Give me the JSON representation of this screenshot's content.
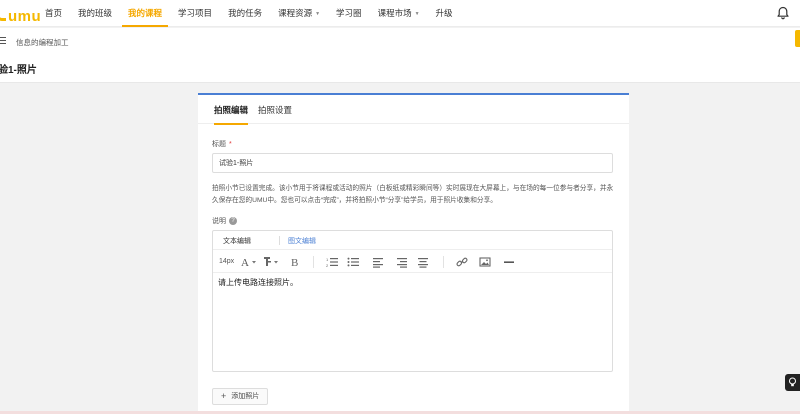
{
  "brand": {
    "name": "umu",
    "accent": "#f5b800",
    "link": "#4a7fd4",
    "required": "#e03b3b"
  },
  "nav": {
    "items": [
      {
        "label": "首页",
        "active": false,
        "dropdown": false
      },
      {
        "label": "我的班级",
        "active": false,
        "dropdown": false
      },
      {
        "label": "我的课程",
        "active": true,
        "dropdown": false
      },
      {
        "label": "学习项目",
        "active": false,
        "dropdown": false
      },
      {
        "label": "我的任务",
        "active": false,
        "dropdown": false
      },
      {
        "label": "课程资源",
        "active": false,
        "dropdown": true
      },
      {
        "label": "学习圈",
        "active": false,
        "dropdown": false
      },
      {
        "label": "课程市场",
        "active": false,
        "dropdown": true
      },
      {
        "label": "升级",
        "active": false,
        "dropdown": false
      }
    ],
    "bell_icon": "bell-icon"
  },
  "header": {
    "breadcrumb": "信息的编程加工",
    "title": "验1-照片"
  },
  "tabs": {
    "edit": "拍照编辑",
    "settings": "拍照设置"
  },
  "form": {
    "title_label": "标题",
    "title_required": "*",
    "title_value": "试验1-照片",
    "description": "拍照小节已设置完成。该小节用于将课程或活动的照片（白板纸或精彩瞬间等）实时展现在大屏幕上，与在场的每一位参与者分享，并永久保存在您的UMU中。您也可以点击“完成”，并将拍照小节“分享”给学员，用于照片收集和分享。",
    "explain_label": "说明",
    "help_icon": "?"
  },
  "editor": {
    "tab_text": "文本编辑",
    "tab_rich": "图文编辑",
    "font_size": "14px",
    "content": "请上传电路连接照片。",
    "toolbar_icons": [
      "font-color-icon",
      "highlight-icon",
      "bold-icon",
      "ordered-list-icon",
      "unordered-list-icon",
      "align-left-icon",
      "align-right-icon",
      "align-center-icon",
      "link-icon",
      "image-icon",
      "horizontal-rule-icon"
    ]
  },
  "add_photo": {
    "plus": "+",
    "label": "添加照片"
  }
}
